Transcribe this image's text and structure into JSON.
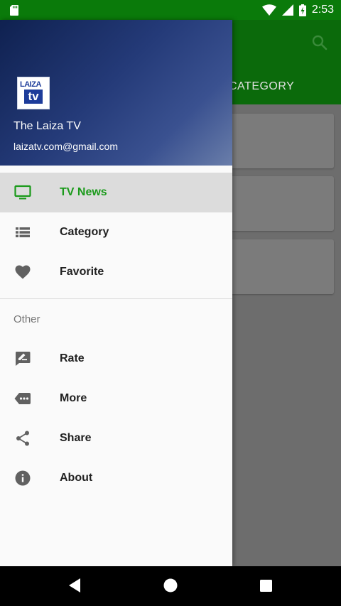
{
  "status_bar": {
    "time": "2:53"
  },
  "app": {
    "tab_label": "CATEGORY"
  },
  "drawer": {
    "logo_top": "LAIZA",
    "logo_bottom": "tv",
    "name": "The Laiza TV",
    "email": "laizatv.com@gmail.com",
    "items": [
      {
        "label": "TV News",
        "icon": "tv-icon",
        "active": true
      },
      {
        "label": "Category",
        "icon": "list-icon"
      },
      {
        "label": "Favorite",
        "icon": "heart-icon"
      }
    ],
    "section_title": "Other",
    "other_items": [
      {
        "label": "Rate",
        "icon": "rate-review-icon"
      },
      {
        "label": "More",
        "icon": "more-label-icon"
      },
      {
        "label": "Share",
        "icon": "share-icon"
      },
      {
        "label": "About",
        "icon": "info-icon"
      }
    ]
  },
  "colors": {
    "accent": "#1a9a1a",
    "status_bar": "#0a7a0a",
    "toolbar": "#0b6a0b"
  }
}
